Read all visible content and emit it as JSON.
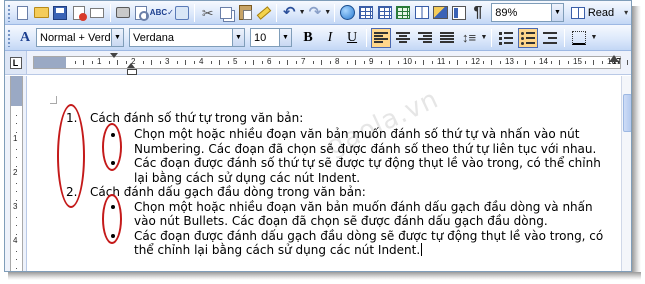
{
  "toolbar_standard": {
    "zoom_value": "89%",
    "read_label": "Read",
    "buttons": [
      "new-document",
      "open",
      "save",
      "permission",
      "email",
      "print",
      "print-preview",
      "spelling-grammar",
      "research",
      "cut",
      "copy",
      "paste",
      "format-painter",
      "undo",
      "redo",
      "insert-hyperlink",
      "tables-and-borders",
      "insert-table",
      "insert-excel-worksheet",
      "columns",
      "drawing",
      "document-map",
      "show-hide"
    ]
  },
  "toolbar_formatting": {
    "style_value": "Normal + Verda",
    "font_value": "Verdana",
    "size_value": "10",
    "bold_label": "B",
    "italic_label": "I",
    "underline_label": "U",
    "style_icon_label": "A",
    "active_alignment": "align-left",
    "active_list": "bullets"
  },
  "ruler": {
    "corner_label": "L",
    "right_marker": "17",
    "horizontal_numbers": [
      "1",
      "2",
      "3",
      "4",
      "5",
      "6",
      "7",
      "8",
      "9",
      "10",
      "11",
      "12",
      "13",
      "14",
      "15",
      "16"
    ],
    "vertical_numbers": [
      "1",
      "2",
      "3",
      "4"
    ]
  },
  "document": {
    "list": [
      {
        "number": "1.",
        "heading": "Cách đánh số thứ tự trong văn bản:",
        "lines": [
          "Chọn một hoặc nhiều đoạn văn bản muốn đánh số thứ tự và nhấn vào nút",
          "Numbering. Các đoạn đã chọn sẽ được đánh số theo thứ tự liên tục với nhau.",
          "Các đoạn được đánh số thứ tự sẽ được tự động thụt lề vào trong, có thể chỉnh",
          "lại bằng cách sử dụng các nút Indent."
        ]
      },
      {
        "number": "2.",
        "heading": "Cách đánh dấu gạch đầu dòng trong văn bản:",
        "lines": [
          "Chọn một hoặc nhiều đoạn văn bản muốn đánh dấu gạch đầu dòng và nhấn",
          "vào nút Bullets. Các đoạn đã chọn sẽ được đánh dấu gạch đầu dòng.",
          "Các đoạn được đánh dấu gạch đầu dòng sẽ được tự động thụt lề vào trong, có",
          "thể chỉnh lại bằng cách sử dụng các nút Indent."
        ]
      }
    ]
  },
  "watermark": "gaola.vn",
  "colors": {
    "annotation": "#c41a1a",
    "toolbar_top": "#f6f9fe",
    "toolbar_bottom": "#c3d7f5",
    "ruler_margin": "#9aa9c4"
  }
}
